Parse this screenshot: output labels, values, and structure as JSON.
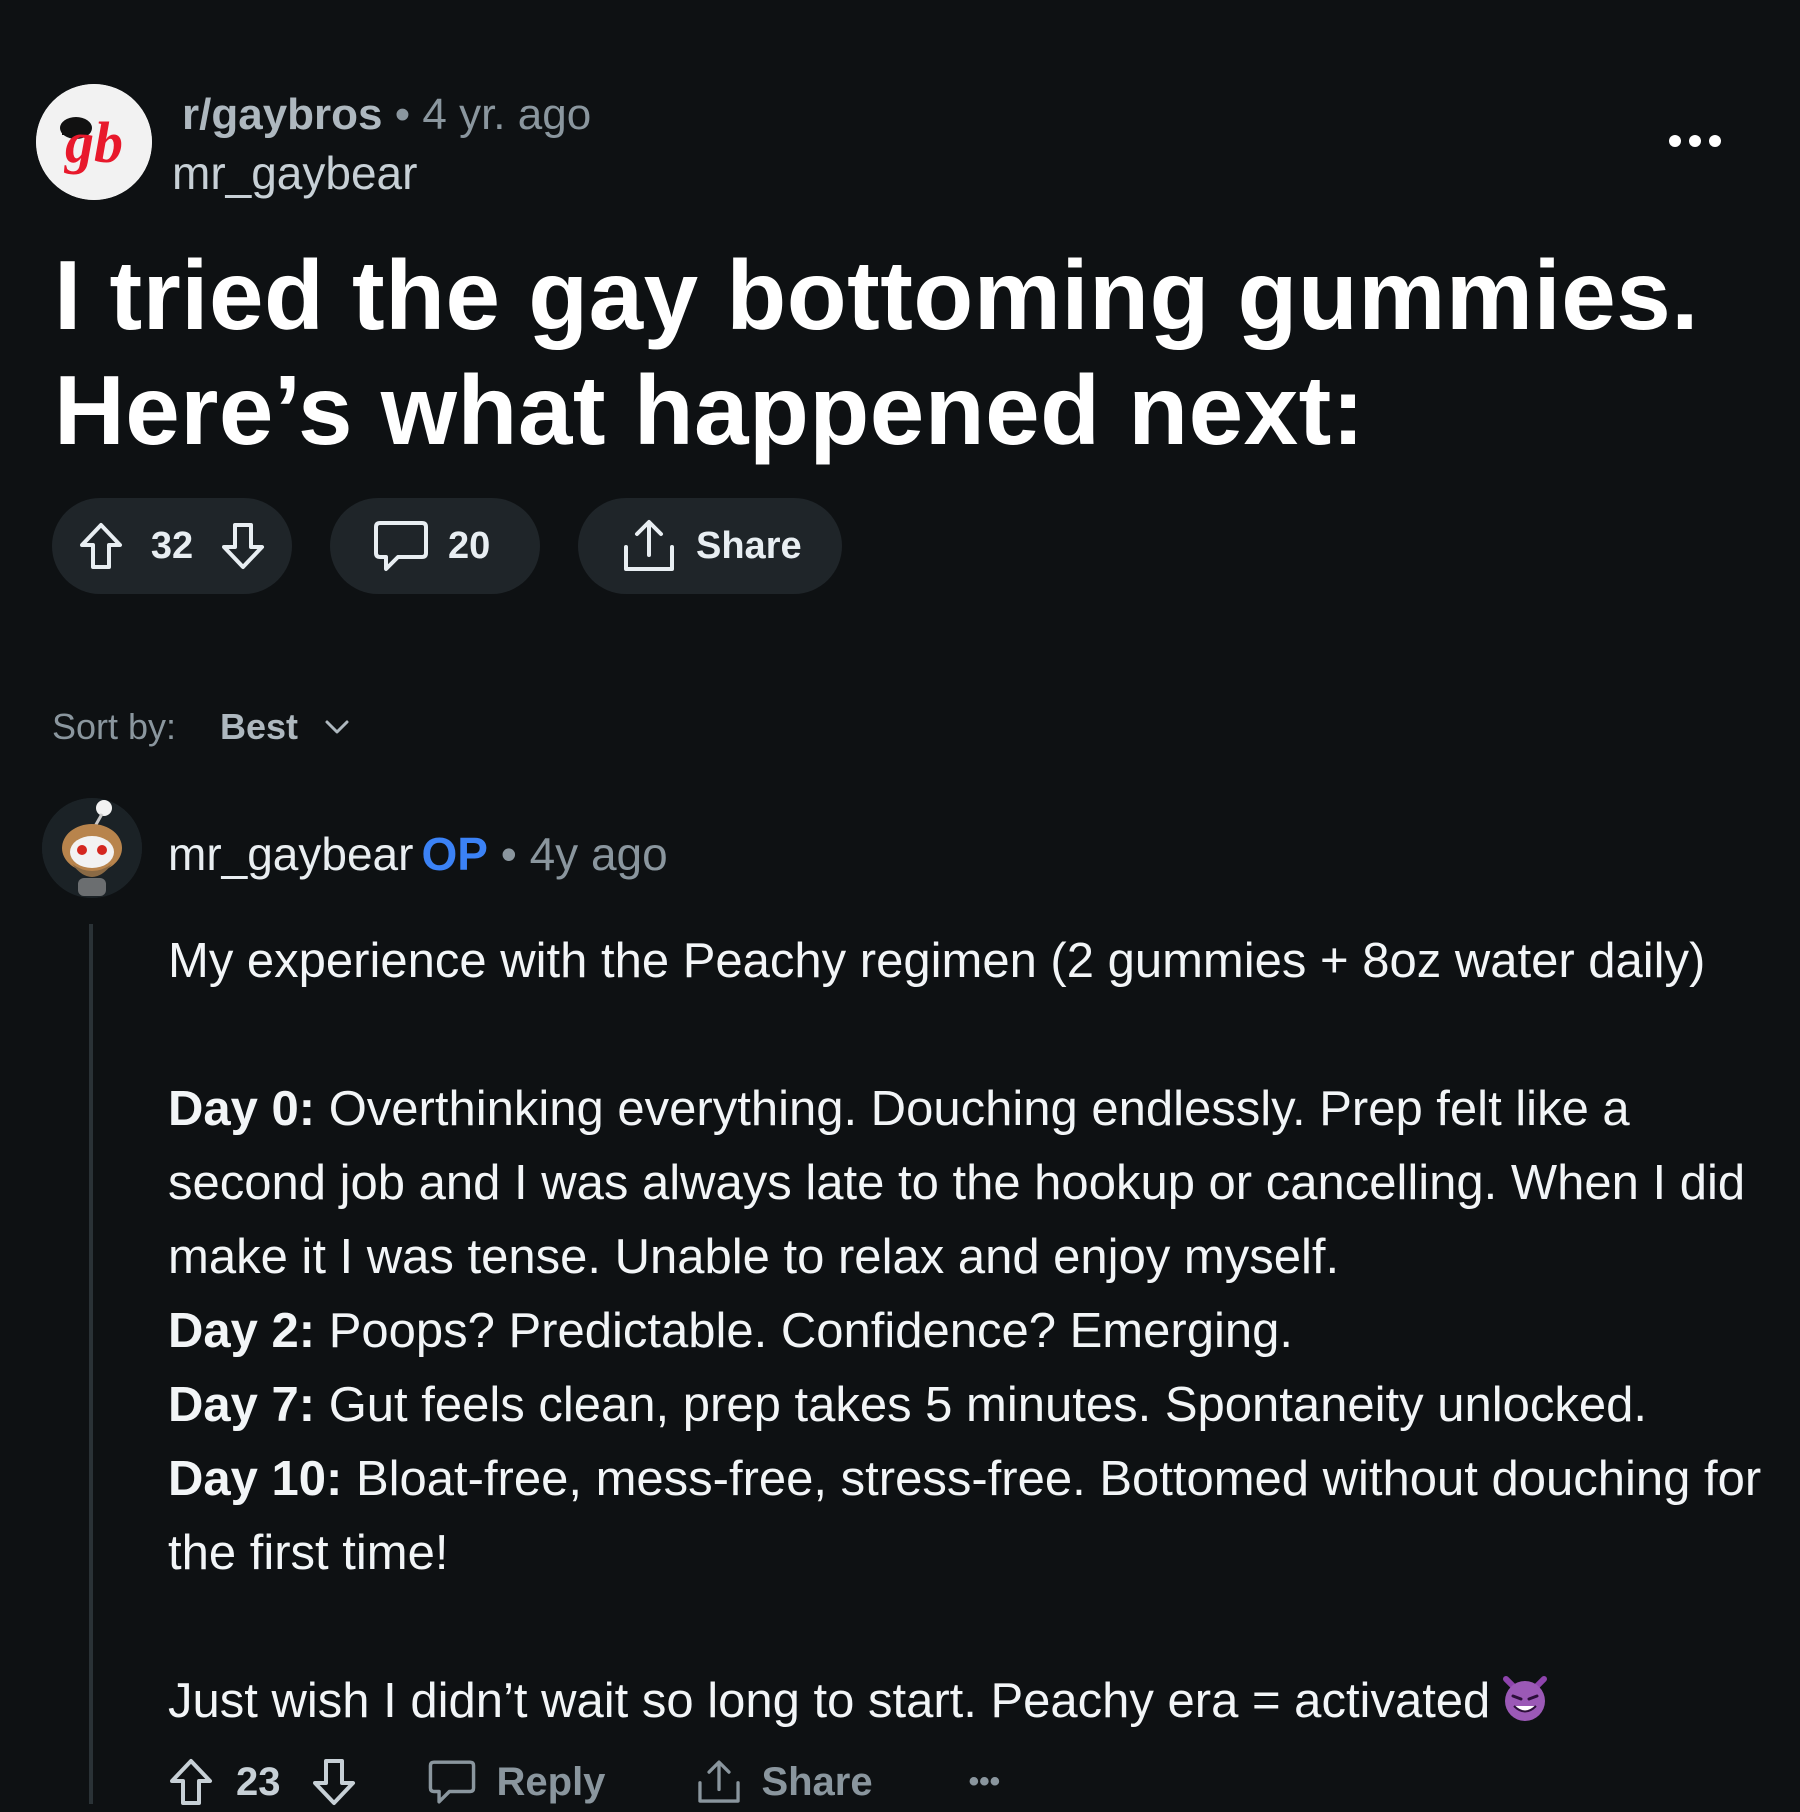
{
  "post": {
    "subreddit": "r/gaybros",
    "dot": "•",
    "time": "4 yr. ago",
    "author": "mr_gaybear",
    "subreddit_logo_text": "gb",
    "title_line1": "I tried the gay bottoming gummies.",
    "title_line2": "Here’s what happened next:",
    "score": "32",
    "comments": "20",
    "share_label": "Share"
  },
  "sort": {
    "label": "Sort by:",
    "value": "Best"
  },
  "comment": {
    "author": "mr_gaybear",
    "op_badge": "OP",
    "dot": "•",
    "time": "4y ago",
    "intro": "My experience with the Peachy regimen (2 gummies + 8oz water daily)",
    "day0_label": "Day 0:",
    "day0_text": " Overthinking everything. Douching endlessly. Prep felt like a second job and I was always late to the hookup or cancelling. When I did make it I was tense. Unable to relax and enjoy myself.",
    "day2_label": "Day 2:",
    "day2_text": " Poops? Predictable. Confidence? Emerging.",
    "day7_label": "Day 7:",
    "day7_text": " Gut feels clean, prep takes 5 minutes. Spontaneity unlocked.",
    "day10_label": "Day 10:",
    "day10_text": " Bloat-free, mess-free, stress-free. Bottomed without douching for the first time!",
    "closing": "Just wish I didn’t wait so long to start. Peachy era = activated",
    "score": "23",
    "reply_label": "Reply",
    "share_label": "Share",
    "more_label": "•••"
  },
  "colors": {
    "background": "#0e1113",
    "pill": "#1f2529",
    "op_blue": "#3b82f6",
    "logo_red": "#e8192c"
  },
  "icons": {
    "subreddit_avatar": "gb-logo",
    "more": "ellipsis-icon",
    "upvote": "arrow-up-icon",
    "downvote": "arrow-down-icon",
    "comment": "speech-bubble-icon",
    "share": "share-upload-icon",
    "sort": "chevron-down-icon",
    "emoji": "smiling-devil-icon"
  }
}
